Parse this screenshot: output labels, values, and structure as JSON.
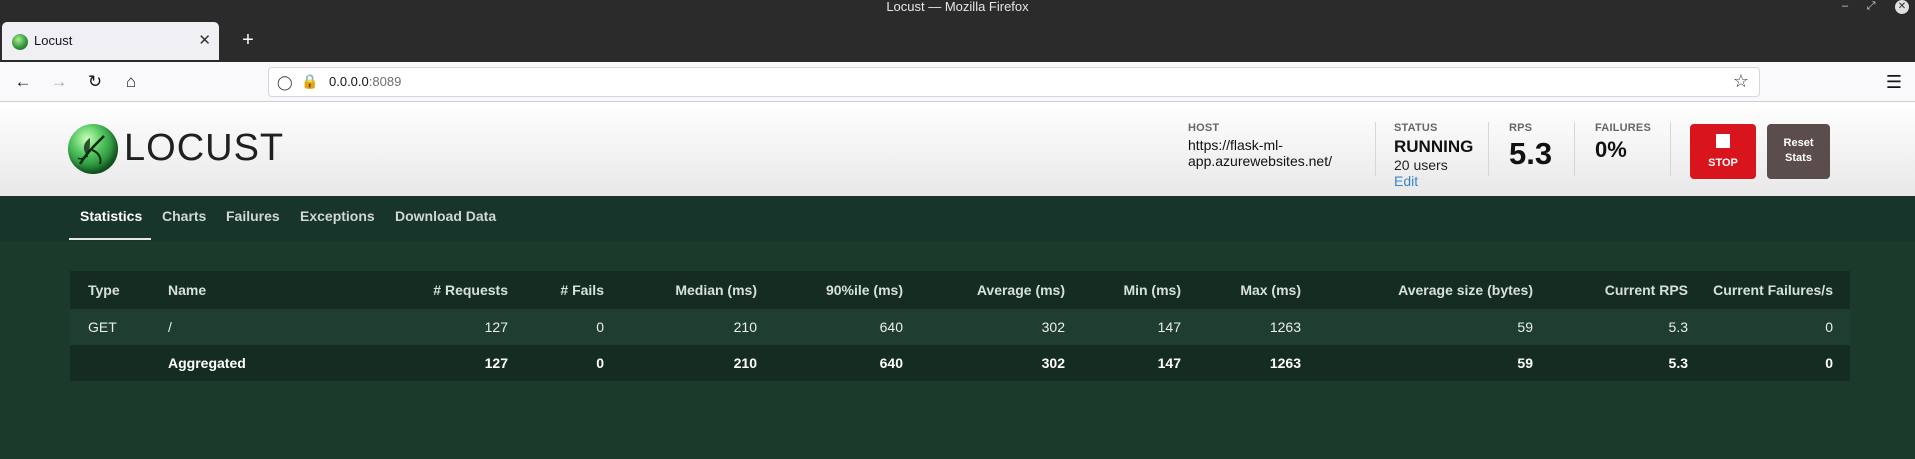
{
  "window": {
    "title": "Locust — Mozilla Firefox"
  },
  "browser": {
    "tab_title": "Locust",
    "url_host": "0.0.0.0",
    "url_port": ":8089"
  },
  "locust": {
    "logo_text": "LOCUST",
    "host_label": "HOST",
    "host_line1": "https://flask-ml-",
    "host_line2": "app.azurewebsites.net/",
    "status_label": "STATUS",
    "status_value": "RUNNING",
    "users": "20 users",
    "edit": "Edit",
    "rps_label": "RPS",
    "rps_value": "5.3",
    "failures_label": "FAILURES",
    "failures_value": "0%",
    "stop_label": "STOP",
    "reset_label_1": "Reset",
    "reset_label_2": "Stats",
    "tabs": [
      "Statistics",
      "Charts",
      "Failures",
      "Exceptions",
      "Download Data"
    ]
  },
  "table": {
    "headers": [
      "Type",
      "Name",
      "# Requests",
      "# Fails",
      "Median (ms)",
      "90%ile (ms)",
      "Average (ms)",
      "Min (ms)",
      "Max (ms)",
      "Average size (bytes)",
      "Current RPS",
      "Current Failures/s"
    ],
    "rows": [
      [
        "GET",
        "/",
        "127",
        "0",
        "210",
        "640",
        "302",
        "147",
        "1263",
        "59",
        "5.3",
        "0"
      ]
    ],
    "aggregated": [
      "",
      "Aggregated",
      "127",
      "0",
      "210",
      "640",
      "302",
      "147",
      "1263",
      "59",
      "5.3",
      "0"
    ]
  }
}
